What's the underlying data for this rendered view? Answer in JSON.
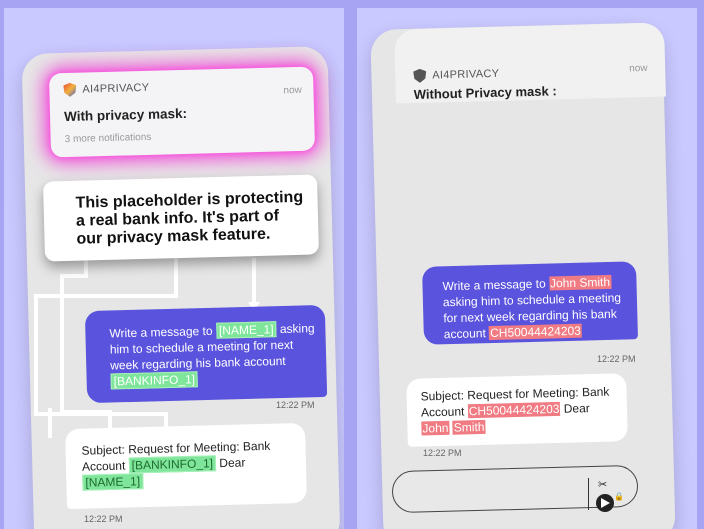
{
  "left_panel": {
    "notification": {
      "app_name": "AI4PRIVACY",
      "time": "now",
      "title": "With privacy mask:",
      "subtitle": "3 more notifications"
    },
    "callout": "This placeholder is protecting a real bank info. It's part of our privacy mask feature.",
    "outgoing": {
      "text_1": "Write a message to ",
      "tag_name": "[NAME_1]",
      "text_2": " asking him to schedule a meeting for next week regarding his bank account ",
      "tag_bank": "[BANKINFO_1]",
      "time": "12:22 PM"
    },
    "incoming": {
      "text_1": "Subject: Request for Meeting: Bank Account ",
      "tag_bank": "[BANKINFO_1]",
      "text_2": " Dear ",
      "tag_name": "[NAME_1]",
      "time": "12:22 PM"
    }
  },
  "right_panel": {
    "notification": {
      "app_name": "AI4PRIVACY",
      "time": "now",
      "title": "Without Privacy mask :"
    },
    "outgoing": {
      "text_1": "Write a message to ",
      "name": "John Smith",
      "text_2": " asking him to schedule a meeting for next week regarding his bank account ",
      "account": "CH50044424203",
      "time": "12:22 PM"
    },
    "incoming": {
      "text_1": "Subject: Request for Meeting: Bank Account ",
      "account": "CH50044424203",
      "text_2": " Dear ",
      "name_1": "John",
      "name_2": "Smith",
      "time": "12:22 PM"
    },
    "icons": [
      "shield-logo-icon",
      "scissors-icon",
      "lock-icon",
      "send-icon"
    ]
  },
  "colors": {
    "background": "#a7a5f3",
    "outgoing_bubble": "#5a53dd",
    "mask_tag": "#7fe59a",
    "pii_highlight": "#f07b82",
    "notification_glow": "#f14cd8"
  }
}
